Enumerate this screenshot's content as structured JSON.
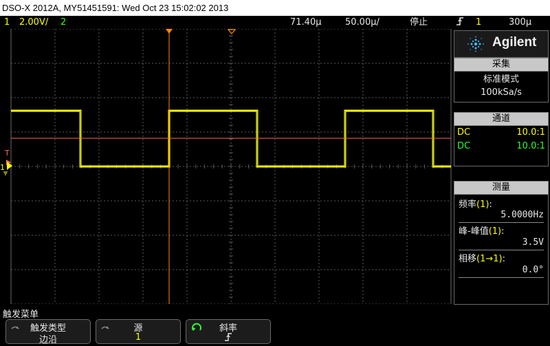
{
  "title_bar": "DSO-X 2012A, MY51451591: Wed Oct 23 15:02:02 2013",
  "status": {
    "ch1_num": "1",
    "ch1_scale": "2.00V/",
    "ch2_num": "2",
    "time_offset": "71.40µ",
    "time_scale": "50.00µ/",
    "run_state": "停止",
    "trig_icon": "rising-edge-icon",
    "trig_source": "1",
    "trig_level": "300µ"
  },
  "brand": "Agilent",
  "acquisition": {
    "header": "采集",
    "mode": "标准模式",
    "rate": "100kSa/s"
  },
  "channels": {
    "header": "通道",
    "items": [
      {
        "coupling": "DC",
        "probe": "10.0:1",
        "color": "#ffff00"
      },
      {
        "coupling": "DC",
        "probe": "10.0:1",
        "color": "#2bff2b"
      }
    ]
  },
  "measurements": {
    "header": "测量",
    "items": [
      {
        "label": "频率",
        "ch": "(1)",
        "suffix": ":",
        "value": "5.0000Hz"
      },
      {
        "label": "峰-峰值",
        "ch": "(1)",
        "suffix": ":",
        "value": "3.5V"
      },
      {
        "label": "相移",
        "ch": "(1→1)",
        "suffix": ":",
        "value": "0.0°"
      }
    ]
  },
  "menu": {
    "title": "触发菜单",
    "keys": [
      {
        "label": "触发类型",
        "value": "边沿"
      },
      {
        "label": "源",
        "value": "1"
      },
      {
        "label": "斜率",
        "value": "rising-slope-icon"
      }
    ]
  },
  "markers": {
    "trigger_label": "T",
    "ch1_ground_label": "1"
  },
  "colors": {
    "ch1": "#ffff00",
    "ch2": "#2bff2b",
    "trigger_level": "#ff6a4a",
    "trigger_marker": "#ff8c00",
    "grid": "#5a5a5a"
  }
}
